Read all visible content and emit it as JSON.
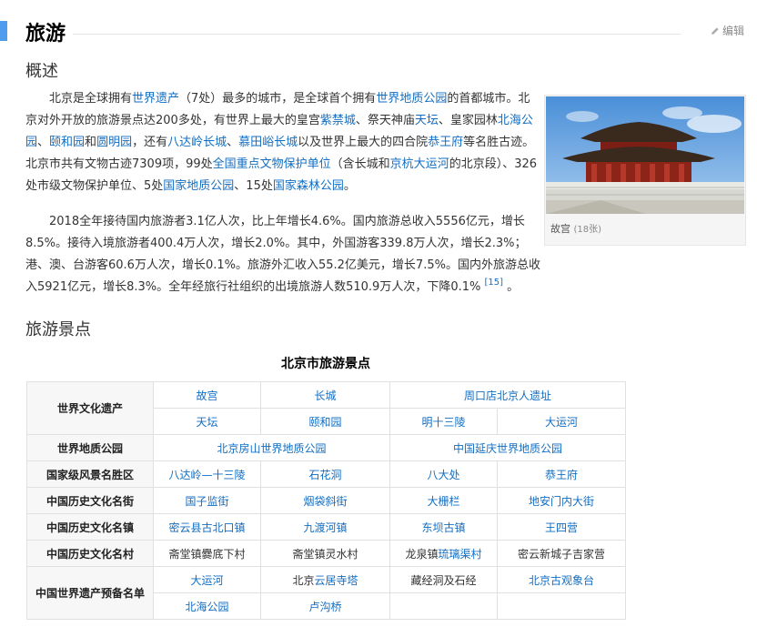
{
  "section_title": "旅游",
  "edit_label": "编辑",
  "subsections": {
    "overview": "概述",
    "sights": "旅游景点"
  },
  "p1": [
    {
      "t": "北京是全球拥有"
    },
    {
      "t": "世界遗产",
      "link": true
    },
    {
      "t": "（7处）最多的城市，是全球首个拥有"
    },
    {
      "t": "世界地质公园",
      "link": true
    },
    {
      "t": "的首都城市。北京对外开放的旅游景点达200多处，有世界上最大的皇宫"
    },
    {
      "t": "紫禁城",
      "link": true
    },
    {
      "t": "、祭天神庙"
    },
    {
      "t": "天坛",
      "link": true
    },
    {
      "t": "、皇家园林"
    },
    {
      "t": "北海公园",
      "link": true
    },
    {
      "t": "、"
    },
    {
      "t": "颐和园",
      "link": true
    },
    {
      "t": "和"
    },
    {
      "t": "圆明园",
      "link": true
    },
    {
      "t": "，还有"
    },
    {
      "t": "八达岭长城",
      "link": true
    },
    {
      "t": "、"
    },
    {
      "t": "慕田峪长城",
      "link": true
    },
    {
      "t": "以及世界上最大的四合院"
    },
    {
      "t": "恭王府",
      "link": true
    },
    {
      "t": "等名胜古迹。北京市共有文物古迹7309项，99处"
    },
    {
      "t": "全国重点文物保护单位",
      "link": true
    },
    {
      "t": "（含长城和"
    },
    {
      "t": "京杭大运河",
      "link": true
    },
    {
      "t": "的北京段）、326处市级文物保护单位、5处"
    },
    {
      "t": "国家地质公园",
      "link": true
    },
    {
      "t": "、15处"
    },
    {
      "t": "国家森林公园",
      "link": true
    },
    {
      "t": "。"
    }
  ],
  "p2": "2018全年接待国内旅游者3.1亿人次，比上年增长4.6%。国内旅游总收入5556亿元，增长8.5%。接待入境旅游者400.4万人次，增长2.0%。其中，外国游客339.8万人次，增长2.3%；港、澳、台游客60.6万人次，增长0.1%。旅游外汇收入55.2亿美元，增长7.5%。国内外旅游总收入5921亿元，增长8.3%。全年经旅行社组织的出境旅游人数510.9万人次，下降0.1%",
  "p2_ref": "[15]",
  "p2_end": " 。",
  "image": {
    "caption": "故宫",
    "count": "(18张)"
  },
  "table": {
    "title": "北京市旅游景点",
    "r1": {
      "head": "世界文化遗产",
      "c1": "故宫",
      "c2": "长城",
      "c3": "周口店北京人遗址"
    },
    "r2": {
      "c1": "天坛",
      "c2": "颐和园",
      "c3": "明十三陵",
      "c4": "大运河"
    },
    "r3": {
      "head": "世界地质公园",
      "c1": "北京房山世界地质公园",
      "c2": "中国延庆世界地质公园"
    },
    "r4": {
      "head": "国家级风景名胜区",
      "c1": "八达岭—十三陵",
      "c2": "石花洞",
      "c3": "八大处",
      "c4": "恭王府"
    },
    "r5": {
      "head": "中国历史文化名街",
      "c1": "国子监街",
      "c2": "烟袋斜街",
      "c3": "大栅栏",
      "c4": "地安门内大街"
    },
    "r6": {
      "head": "中国历史文化名镇",
      "c1": "密云县古北口镇",
      "c2": "九渡河镇",
      "c3": "东坝古镇",
      "c4": "王四营"
    },
    "r7": {
      "head": "中国历史文化名村",
      "c1": "斋堂镇爨底下村",
      "c2": "斋堂镇灵水村",
      "c3a": "龙泉镇",
      "c3b": "琉璃渠村",
      "c4": "密云新城子吉家营"
    },
    "r8": {
      "head": "中国世界遗产预备名单",
      "c1": "大运河",
      "c2a": "北京",
      "c2b": "云居寺塔",
      "c3": "藏经洞及石经",
      "c4": "北京古观象台"
    },
    "r9": {
      "c1": "北海公园",
      "c2": "卢沟桥"
    }
  }
}
